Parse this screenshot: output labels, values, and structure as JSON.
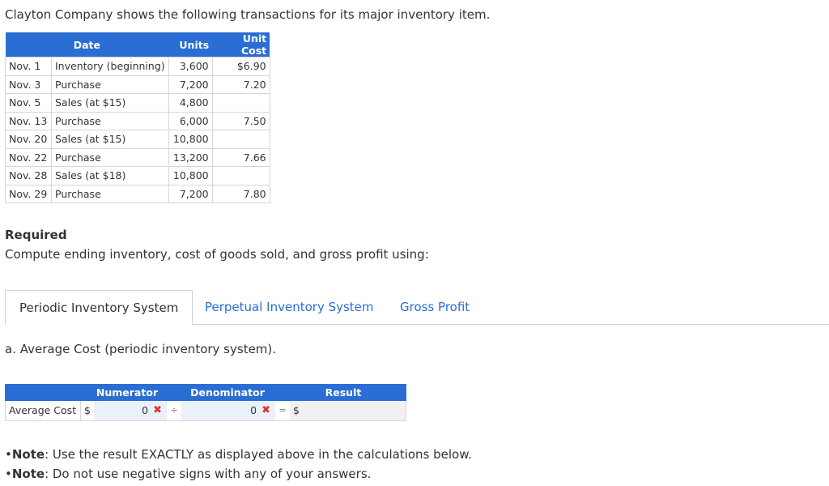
{
  "intro": "Clayton Company shows the following transactions for its major inventory item.",
  "inventory": {
    "headers": [
      "Date",
      "Units",
      "Unit Cost"
    ],
    "rows": [
      {
        "date": "Nov. 1",
        "desc": "Inventory (beginning)",
        "units": "3,600",
        "cost": "$6.90"
      },
      {
        "date": "Nov. 3",
        "desc": "Purchase",
        "units": "7,200",
        "cost": "7.20"
      },
      {
        "date": "Nov. 5",
        "desc": "Sales (at $15)",
        "units": "4,800",
        "cost": ""
      },
      {
        "date": "Nov. 13",
        "desc": "Purchase",
        "units": "6,000",
        "cost": "7.50"
      },
      {
        "date": "Nov. 20",
        "desc": "Sales (at $15)",
        "units": "10,800",
        "cost": ""
      },
      {
        "date": "Nov. 22",
        "desc": "Purchase",
        "units": "13,200",
        "cost": "7.66"
      },
      {
        "date": "Nov. 28",
        "desc": "Sales (at $18)",
        "units": "10,800",
        "cost": ""
      },
      {
        "date": "Nov. 29",
        "desc": "Purchase",
        "units": "7,200",
        "cost": "7.80"
      }
    ]
  },
  "required": {
    "heading": "Required",
    "text": "Compute ending inventory, cost of goods sold, and gross profit using:"
  },
  "tabs": [
    {
      "label": "Periodic Inventory System",
      "active": true
    },
    {
      "label": "Perpetual Inventory System",
      "active": false
    },
    {
      "label": "Gross Profit",
      "active": false
    }
  ],
  "question": "a. Average Cost (periodic inventory system).",
  "calc": {
    "headers": [
      "Numerator",
      "Denominator",
      "Result"
    ],
    "row_label": "Average Cost",
    "currency": "$",
    "numerator_value": "0",
    "denominator_value": "0",
    "divide_symbol": "÷",
    "equals_symbol": "=",
    "result_currency": "$",
    "result_value": "",
    "wrong_mark": "✖"
  },
  "notes": [
    {
      "label": "Note",
      "text": ": Use the result EXACTLY as displayed above in the calculations below."
    },
    {
      "label": "Note",
      "text": ": Do not use negative signs with any of your answers."
    }
  ],
  "colors": {
    "accent": "#2a6ed4",
    "error": "#d9342b",
    "input_bg": "#eaf1fb"
  }
}
